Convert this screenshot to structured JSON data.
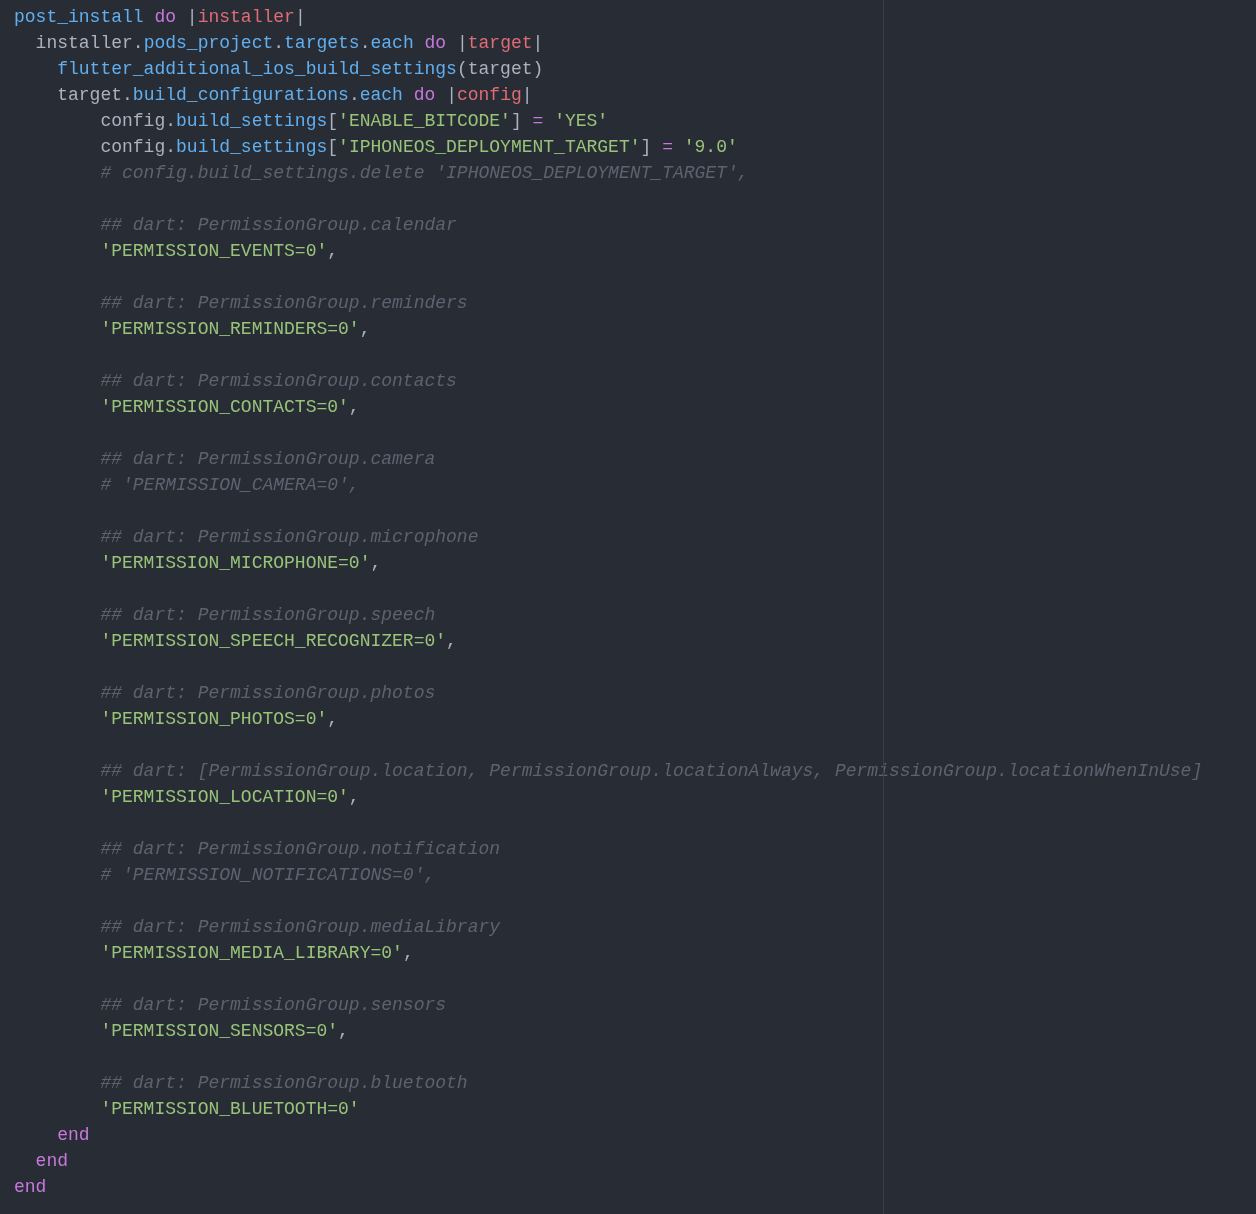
{
  "editor": {
    "lines": [
      {
        "kind": "code",
        "tokens": [
          {
            "text": "post_install",
            "kind": "method"
          },
          {
            "text": " do ",
            "kind": "keyword"
          },
          {
            "text": "|",
            "kind": "plain"
          },
          {
            "text": "installer",
            "kind": "variable"
          },
          {
            "text": "|",
            "kind": "plain"
          }
        ]
      },
      {
        "kind": "code",
        "tokens": [
          {
            "text": "  installer.",
            "kind": "plain"
          },
          {
            "text": "pods_project",
            "kind": "method"
          },
          {
            "text": ".",
            "kind": "plain"
          },
          {
            "text": "targets",
            "kind": "method"
          },
          {
            "text": ".",
            "kind": "plain"
          },
          {
            "text": "each",
            "kind": "method"
          },
          {
            "text": " do ",
            "kind": "keyword"
          },
          {
            "text": "|",
            "kind": "plain"
          },
          {
            "text": "target",
            "kind": "variable"
          },
          {
            "text": "|",
            "kind": "plain"
          }
        ]
      },
      {
        "kind": "code",
        "tokens": [
          {
            "text": "    flutter_additional_ios_build_settings",
            "kind": "method"
          },
          {
            "text": "(target)",
            "kind": "plain"
          }
        ]
      },
      {
        "kind": "code",
        "tokens": [
          {
            "text": "    target.",
            "kind": "plain"
          },
          {
            "text": "build_configurations",
            "kind": "method"
          },
          {
            "text": ".",
            "kind": "plain"
          },
          {
            "text": "each",
            "kind": "method"
          },
          {
            "text": " do ",
            "kind": "keyword"
          },
          {
            "text": "|",
            "kind": "plain"
          },
          {
            "text": "config",
            "kind": "variable"
          },
          {
            "text": "|",
            "kind": "plain"
          }
        ]
      },
      {
        "kind": "code",
        "tokens": [
          {
            "text": "        config.",
            "kind": "plain"
          },
          {
            "text": "build_settings",
            "kind": "method"
          },
          {
            "text": "[",
            "kind": "plain"
          },
          {
            "text": "'ENABLE_BITCODE'",
            "kind": "string"
          },
          {
            "text": "] ",
            "kind": "plain"
          },
          {
            "text": "= ",
            "kind": "operator"
          },
          {
            "text": "'YES'",
            "kind": "string"
          }
        ]
      },
      {
        "kind": "code",
        "tokens": [
          {
            "text": "        config.",
            "kind": "plain"
          },
          {
            "text": "build_settings",
            "kind": "method"
          },
          {
            "text": "[",
            "kind": "plain"
          },
          {
            "text": "'IPHONEOS_DEPLOYMENT_TARGET'",
            "kind": "string"
          },
          {
            "text": "] ",
            "kind": "plain"
          },
          {
            "text": "= ",
            "kind": "operator"
          },
          {
            "text": "'9.0'",
            "kind": "string"
          }
        ]
      },
      {
        "kind": "code",
        "tokens": [
          {
            "text": "        # config.build_settings.delete 'IPHONEOS_DEPLOYMENT_TARGET',",
            "kind": "comment"
          }
        ]
      },
      {
        "kind": "blank"
      },
      {
        "kind": "code",
        "tokens": [
          {
            "text": "        ## dart: PermissionGroup.calendar",
            "kind": "comment"
          }
        ]
      },
      {
        "kind": "code",
        "tokens": [
          {
            "text": "        'PERMISSION_EVENTS=0'",
            "kind": "string"
          },
          {
            "text": ",",
            "kind": "plain"
          }
        ]
      },
      {
        "kind": "blank"
      },
      {
        "kind": "code",
        "tokens": [
          {
            "text": "        ## dart: PermissionGroup.reminders",
            "kind": "comment"
          }
        ]
      },
      {
        "kind": "code",
        "tokens": [
          {
            "text": "        'PERMISSION_REMINDERS=0'",
            "kind": "string"
          },
          {
            "text": ",",
            "kind": "plain"
          }
        ]
      },
      {
        "kind": "blank"
      },
      {
        "kind": "code",
        "tokens": [
          {
            "text": "        ## dart: PermissionGroup.contacts",
            "kind": "comment"
          }
        ]
      },
      {
        "kind": "code",
        "tokens": [
          {
            "text": "        'PERMISSION_CONTACTS=0'",
            "kind": "string"
          },
          {
            "text": ",",
            "kind": "plain"
          }
        ]
      },
      {
        "kind": "blank"
      },
      {
        "kind": "code",
        "tokens": [
          {
            "text": "        ## dart: PermissionGroup.camera",
            "kind": "comment"
          }
        ]
      },
      {
        "kind": "code",
        "tokens": [
          {
            "text": "        # 'PERMISSION_CAMERA=0',",
            "kind": "comment"
          }
        ]
      },
      {
        "kind": "blank"
      },
      {
        "kind": "code",
        "tokens": [
          {
            "text": "        ## dart: PermissionGroup.microphone",
            "kind": "comment"
          }
        ]
      },
      {
        "kind": "code",
        "tokens": [
          {
            "text": "        'PERMISSION_MICROPHONE=0'",
            "kind": "string"
          },
          {
            "text": ",",
            "kind": "plain"
          }
        ]
      },
      {
        "kind": "blank"
      },
      {
        "kind": "code",
        "tokens": [
          {
            "text": "        ## dart: PermissionGroup.speech",
            "kind": "comment"
          }
        ]
      },
      {
        "kind": "code",
        "tokens": [
          {
            "text": "        'PERMISSION_SPEECH_RECOGNIZER=0'",
            "kind": "string"
          },
          {
            "text": ",",
            "kind": "plain"
          }
        ]
      },
      {
        "kind": "blank"
      },
      {
        "kind": "code",
        "tokens": [
          {
            "text": "        ## dart: PermissionGroup.photos",
            "kind": "comment"
          }
        ]
      },
      {
        "kind": "code",
        "tokens": [
          {
            "text": "        'PERMISSION_PHOTOS=0'",
            "kind": "string"
          },
          {
            "text": ",",
            "kind": "plain"
          }
        ]
      },
      {
        "kind": "blank"
      },
      {
        "kind": "code",
        "tokens": [
          {
            "text": "        ## dart: [PermissionGroup.location, PermissionGroup.locationAlways, PermissionGroup.locationWhenInUse]",
            "kind": "comment"
          }
        ]
      },
      {
        "kind": "code",
        "tokens": [
          {
            "text": "        'PERMISSION_LOCATION=0'",
            "kind": "string"
          },
          {
            "text": ",",
            "kind": "plain"
          }
        ]
      },
      {
        "kind": "blank"
      },
      {
        "kind": "code",
        "tokens": [
          {
            "text": "        ## dart: PermissionGroup.notification",
            "kind": "comment"
          }
        ]
      },
      {
        "kind": "code",
        "tokens": [
          {
            "text": "        # 'PERMISSION_NOTIFICATIONS=0',",
            "kind": "comment"
          }
        ]
      },
      {
        "kind": "blank"
      },
      {
        "kind": "code",
        "tokens": [
          {
            "text": "        ## dart: PermissionGroup.mediaLibrary",
            "kind": "comment"
          }
        ]
      },
      {
        "kind": "code",
        "tokens": [
          {
            "text": "        'PERMISSION_MEDIA_LIBRARY=0'",
            "kind": "string"
          },
          {
            "text": ",",
            "kind": "plain"
          }
        ]
      },
      {
        "kind": "blank"
      },
      {
        "kind": "code",
        "tokens": [
          {
            "text": "        ## dart: PermissionGroup.sensors",
            "kind": "comment"
          }
        ]
      },
      {
        "kind": "code",
        "tokens": [
          {
            "text": "        'PERMISSION_SENSORS=0'",
            "kind": "string"
          },
          {
            "text": ",",
            "kind": "plain"
          }
        ]
      },
      {
        "kind": "blank"
      },
      {
        "kind": "code",
        "tokens": [
          {
            "text": "        ## dart: PermissionGroup.bluetooth",
            "kind": "comment"
          }
        ]
      },
      {
        "kind": "code",
        "tokens": [
          {
            "text": "        'PERMISSION_BLUETOOTH=0'",
            "kind": "string"
          }
        ]
      },
      {
        "kind": "code",
        "tokens": [
          {
            "text": "    end",
            "kind": "keyword"
          }
        ]
      },
      {
        "kind": "code",
        "tokens": [
          {
            "text": "  end",
            "kind": "keyword"
          }
        ]
      },
      {
        "kind": "code",
        "tokens": [
          {
            "text": "end",
            "kind": "keyword"
          }
        ]
      }
    ]
  }
}
